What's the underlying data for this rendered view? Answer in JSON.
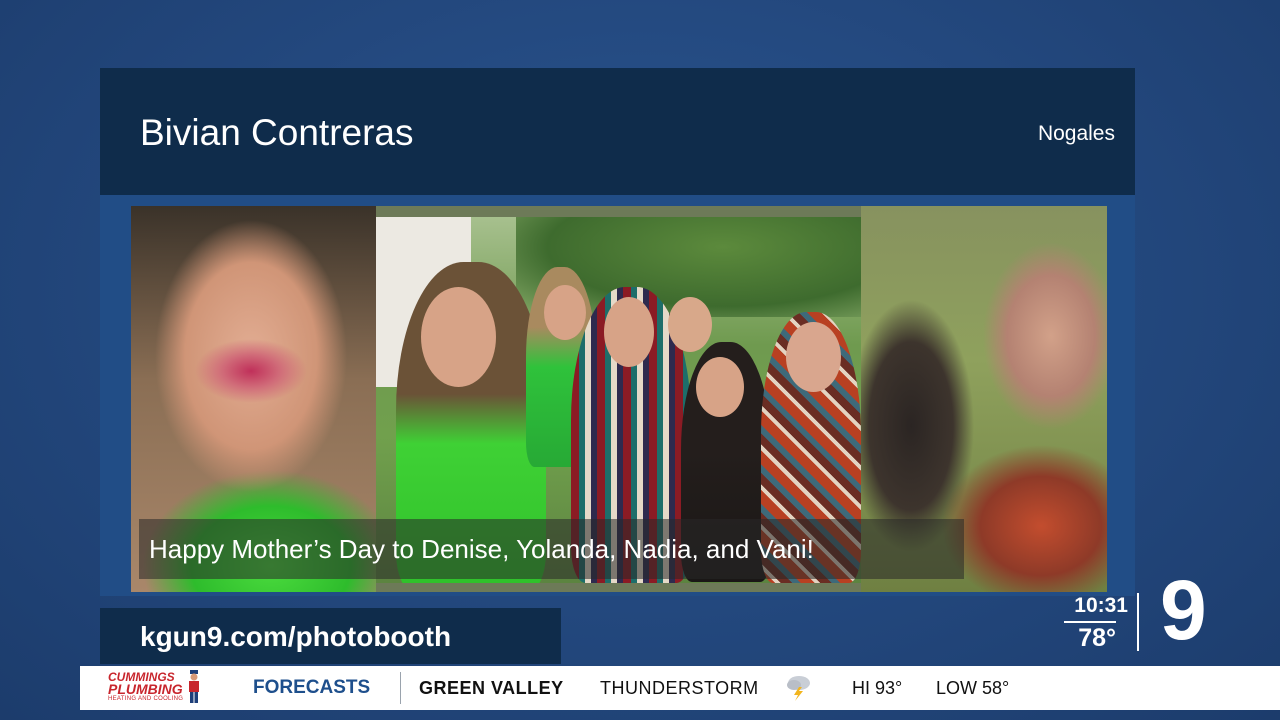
{
  "header": {
    "name": "Bivian Contreras",
    "location": "Nogales"
  },
  "photo": {
    "caption": "Happy Mother’s Day to Denise, Yolanda, Nadia, and Vani!"
  },
  "footer": {
    "url": "kgun9.com/photobooth",
    "time": "10:31",
    "temperature": "78°",
    "station_logo": "9"
  },
  "ticker": {
    "sponsor": {
      "line1": "CUMMINGS",
      "line2": "PLUMBING",
      "line3": "HEATING AND COOLING"
    },
    "section": "FORECASTS",
    "location": "GREEN VALLEY",
    "condition": "THUNDERSTORM",
    "condition_icon": "thunderstorm-icon",
    "hi": "HI 93°",
    "low": "LOW 58°"
  },
  "colors": {
    "background": "#254b82",
    "panel": "#0f2c4b",
    "accent": "#1e4f8c",
    "sponsor": "#c8262d"
  }
}
